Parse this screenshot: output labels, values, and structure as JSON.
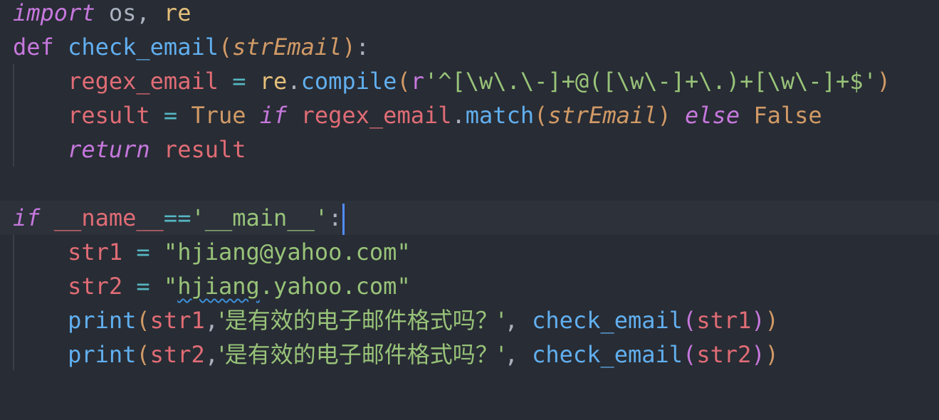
{
  "colors": {
    "background": "#282c34",
    "current_line": "#2c313a",
    "keyword": "#c678dd",
    "function": "#61afef",
    "variable": "#e06c75",
    "string": "#98c379",
    "operator": "#56b6c2",
    "param": "#d19a66",
    "plain": "#abb2bf",
    "cursor": "#528bff"
  },
  "editor": {
    "language": "python",
    "cursor_line": 6,
    "lines": [
      {
        "tokens": [
          {
            "text": "import",
            "color": "#c678dd",
            "italic": true
          },
          {
            "text": " os",
            "color": "#abb2bf"
          },
          {
            "text": ",",
            "color": "#abb2bf"
          },
          {
            "text": " re",
            "color": "#e5c07b"
          }
        ]
      },
      {
        "tokens": [
          {
            "text": "def",
            "color": "#c678dd"
          },
          {
            "text": " check_email",
            "color": "#61afef"
          },
          {
            "text": "(",
            "color": "#d19a66"
          },
          {
            "text": "strEmail",
            "color": "#d19a66",
            "italic": true
          },
          {
            "text": ")",
            "color": "#d19a66"
          },
          {
            "text": ":",
            "color": "#abb2bf"
          }
        ]
      },
      {
        "tokens": [
          {
            "text": "    regex_email",
            "color": "#e06c75"
          },
          {
            "text": " = ",
            "color": "#56b6c2"
          },
          {
            "text": "re",
            "color": "#e5c07b"
          },
          {
            "text": ".",
            "color": "#abb2bf"
          },
          {
            "text": "compile",
            "color": "#61afef"
          },
          {
            "text": "(",
            "color": "#d19a66"
          },
          {
            "text": "r",
            "color": "#c678dd"
          },
          {
            "text": "'^[\\w\\.\\-]+@([\\w\\-]+\\.)+[\\w\\-]+$'",
            "color": "#98c379"
          },
          {
            "text": ")",
            "color": "#d19a66"
          }
        ]
      },
      {
        "tokens": [
          {
            "text": "    result",
            "color": "#e06c75"
          },
          {
            "text": " = ",
            "color": "#56b6c2"
          },
          {
            "text": "True",
            "color": "#d19a66"
          },
          {
            "text": " if",
            "color": "#c678dd",
            "italic": true
          },
          {
            "text": " regex_email",
            "color": "#e06c75"
          },
          {
            "text": ".",
            "color": "#abb2bf"
          },
          {
            "text": "match",
            "color": "#61afef"
          },
          {
            "text": "(",
            "color": "#d19a66"
          },
          {
            "text": "strEmail",
            "color": "#d19a66",
            "italic": true
          },
          {
            "text": ")",
            "color": "#d19a66"
          },
          {
            "text": " else",
            "color": "#c678dd",
            "italic": true
          },
          {
            "text": " False",
            "color": "#d19a66"
          }
        ]
      },
      {
        "tokens": [
          {
            "text": "    return",
            "color": "#c678dd",
            "italic": true
          },
          {
            "text": " result",
            "color": "#e06c75"
          }
        ]
      },
      {
        "tokens": []
      },
      {
        "tokens": [
          {
            "text": "if",
            "color": "#c678dd",
            "italic": true
          },
          {
            "text": " __name__",
            "color": "#e06c75"
          },
          {
            "text": "==",
            "color": "#56b6c2"
          },
          {
            "text": "'__main__'",
            "color": "#98c379"
          },
          {
            "text": ":",
            "color": "#abb2bf"
          }
        ]
      },
      {
        "tokens": [
          {
            "text": "    str1",
            "color": "#e06c75"
          },
          {
            "text": " = ",
            "color": "#56b6c2"
          },
          {
            "text": "\"hjiang@yahoo.com\"",
            "color": "#98c379"
          }
        ]
      },
      {
        "tokens": [
          {
            "text": "    str2",
            "color": "#e06c75"
          },
          {
            "text": " = ",
            "color": "#56b6c2"
          },
          {
            "text": "\"",
            "color": "#98c379"
          },
          {
            "text": "hjiang",
            "color": "#98c379",
            "squiggle": true
          },
          {
            "text": ".yahoo.com\"",
            "color": "#98c379"
          }
        ]
      },
      {
        "tokens": [
          {
            "text": "    print",
            "color": "#61afef"
          },
          {
            "text": "(",
            "color": "#d19a66"
          },
          {
            "text": "str1",
            "color": "#e06c75"
          },
          {
            "text": ",",
            "color": "#abb2bf"
          },
          {
            "text": "'是有效的电子邮件格式吗？'",
            "color": "#98c379",
            "cjk": true
          },
          {
            "text": ", ",
            "color": "#abb2bf"
          },
          {
            "text": "check_email",
            "color": "#61afef"
          },
          {
            "text": "(",
            "color": "#c678dd"
          },
          {
            "text": "str1",
            "color": "#e06c75"
          },
          {
            "text": ")",
            "color": "#c678dd"
          },
          {
            "text": ")",
            "color": "#d19a66"
          }
        ]
      },
      {
        "tokens": [
          {
            "text": "    print",
            "color": "#61afef"
          },
          {
            "text": "(",
            "color": "#d19a66"
          },
          {
            "text": "str2",
            "color": "#e06c75"
          },
          {
            "text": ",",
            "color": "#abb2bf"
          },
          {
            "text": "'是有效的电子邮件格式吗？'",
            "color": "#98c379",
            "cjk": true
          },
          {
            "text": ", ",
            "color": "#abb2bf"
          },
          {
            "text": "check_email",
            "color": "#61afef"
          },
          {
            "text": "(",
            "color": "#c678dd"
          },
          {
            "text": "str2",
            "color": "#e06c75"
          },
          {
            "text": ")",
            "color": "#c678dd"
          },
          {
            "text": ")",
            "color": "#d19a66"
          }
        ]
      }
    ]
  }
}
